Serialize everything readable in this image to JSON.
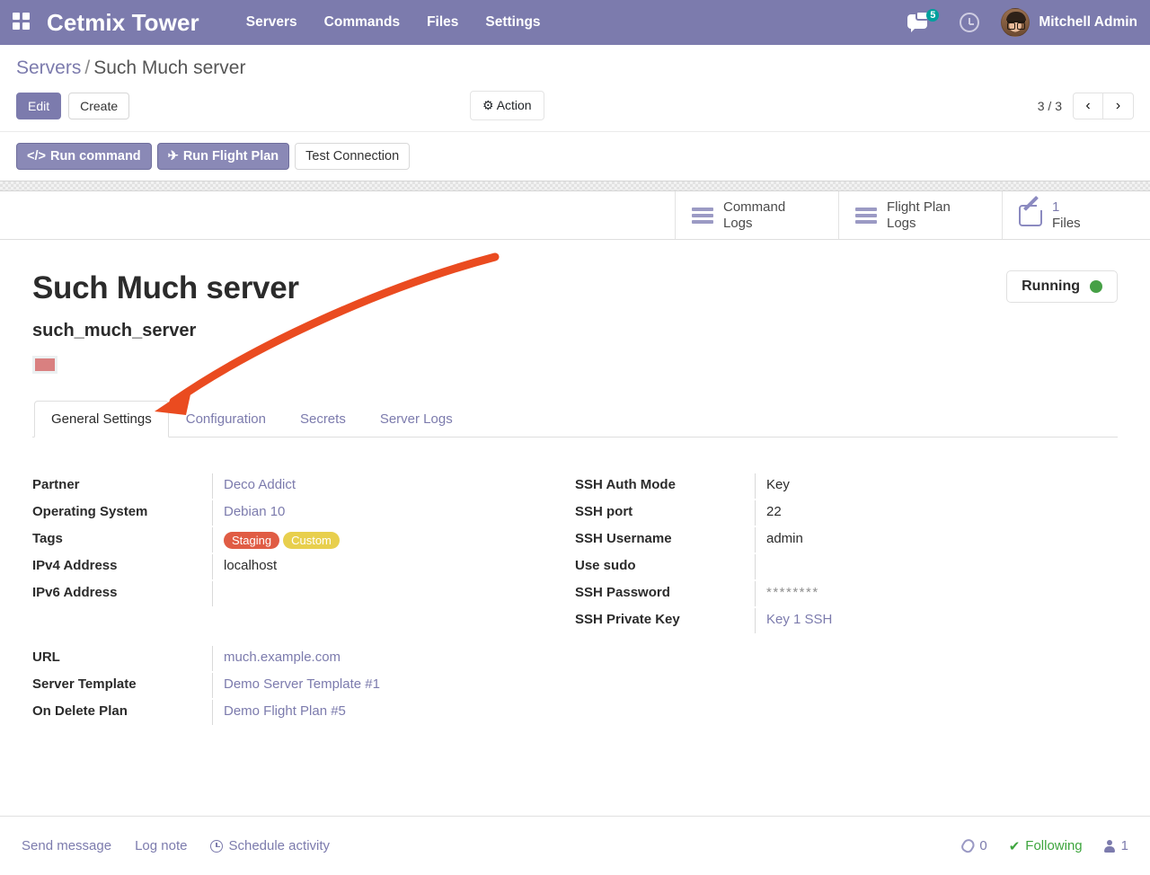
{
  "navbar": {
    "apps_icon": "apps-grid-icon",
    "brand": "Cetmix Tower",
    "menu": [
      {
        "label": "Servers"
      },
      {
        "label": "Commands"
      },
      {
        "label": "Files"
      },
      {
        "label": "Settings"
      }
    ],
    "messages_icon": "message-bubble-icon",
    "messages_count": "5",
    "activities_icon": "clock-icon",
    "user": "Mitchell Admin",
    "accent": "#7c7bad"
  },
  "control_panel": {
    "breadcrumb_root": "Servers",
    "breadcrumb_separator": "/",
    "breadcrumb_current": "Such Much server",
    "edit_label": "Edit",
    "create_label": "Create",
    "action_label": "Action",
    "action_icon": "gear-icon",
    "pager_value": "3 / 3",
    "prev_icon": "chevron-left-icon",
    "next_icon": "chevron-right-icon",
    "buttons": [
      {
        "label": "Run command",
        "icon": "code-icon",
        "style": "primary"
      },
      {
        "label": "Run Flight Plan",
        "icon": "plane-icon",
        "style": "primary"
      },
      {
        "label": "Test Connection",
        "icon": "",
        "style": "ghost"
      }
    ]
  },
  "stat_buttons": [
    {
      "icon": "list-lines-icon",
      "count": "",
      "line1": "Command",
      "line2": "Logs"
    },
    {
      "icon": "list-lines-icon",
      "count": "",
      "line1": "Flight Plan",
      "line2": "Logs"
    },
    {
      "icon": "pencil-square-icon",
      "count": "1",
      "line1": "",
      "line2": "Files"
    }
  ],
  "record": {
    "title": "Such Much server",
    "subtitle": "such_much_server",
    "color_swatch": "#d98080",
    "status_label": "Running",
    "status_color": "#46a046"
  },
  "tabs": [
    {
      "label": "General Settings",
      "active": true
    },
    {
      "label": "Configuration",
      "active": false
    },
    {
      "label": "Secrets",
      "active": false
    },
    {
      "label": "Server Logs",
      "active": false
    }
  ],
  "fields": {
    "left_group1": [
      {
        "label": "Partner",
        "value": "Deco Addict",
        "type": "link"
      },
      {
        "label": "Operating System",
        "value": "Debian 10",
        "type": "link"
      },
      {
        "label": "Tags",
        "value": "",
        "type": "tags"
      },
      {
        "label": "IPv4 Address",
        "value": "localhost",
        "type": "text"
      },
      {
        "label": "IPv6 Address",
        "value": "",
        "type": "text"
      }
    ],
    "tags": [
      {
        "label": "Staging",
        "color": "#e05c44"
      },
      {
        "label": "Custom",
        "color": "#e8cf4d"
      }
    ],
    "right_group1": [
      {
        "label": "SSH Auth Mode",
        "value": "Key",
        "type": "text"
      },
      {
        "label": "SSH port",
        "value": "22",
        "type": "text"
      },
      {
        "label": "SSH Username",
        "value": "admin",
        "type": "text"
      },
      {
        "label": "Use sudo",
        "value": "",
        "type": "text"
      },
      {
        "label": "SSH Password",
        "value": "********",
        "type": "muted"
      },
      {
        "label": "SSH Private Key",
        "value": "Key 1 SSH",
        "type": "link"
      }
    ],
    "left_group2": [
      {
        "label": "URL",
        "value": "much.example.com",
        "type": "link"
      },
      {
        "label": "Server Template",
        "value": "Demo Server Template #1",
        "type": "link"
      },
      {
        "label": "On Delete Plan",
        "value": "Demo Flight Plan #5",
        "type": "link"
      }
    ]
  },
  "chatter": {
    "send_message": "Send message",
    "log_note": "Log note",
    "schedule_activity": "Schedule activity",
    "schedule_icon": "clock-icon",
    "attachment_icon": "paperclip-icon",
    "attachment_count": "0",
    "following_label": "Following",
    "following_icon": "check-icon",
    "followers_icon": "person-icon",
    "followers_count": "1"
  },
  "annotation": {
    "type": "arrow",
    "color": "#ea4b20",
    "points_to": "General Settings tab"
  }
}
